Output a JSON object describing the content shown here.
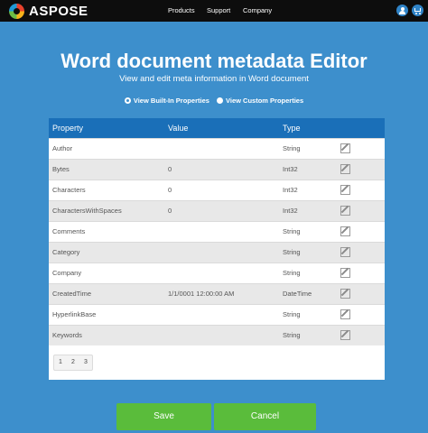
{
  "nav": {
    "brand": "ASPOSE",
    "products": "Products",
    "support": "Support",
    "company": "Company"
  },
  "header": {
    "title": "Word document metadata Editor",
    "subtitle": "View and edit meta information in Word document"
  },
  "view_options": [
    {
      "label": "View Built-In Properties",
      "selected": true
    },
    {
      "label": "View Custom Properties",
      "selected": false
    }
  ],
  "table": {
    "columns": [
      "Property",
      "Value",
      "Type"
    ],
    "rows": [
      {
        "property": "Author",
        "value": "",
        "type": "String"
      },
      {
        "property": "Bytes",
        "value": "0",
        "type": "Int32"
      },
      {
        "property": "Characters",
        "value": "0",
        "type": "Int32"
      },
      {
        "property": "CharactersWithSpaces",
        "value": "0",
        "type": "Int32"
      },
      {
        "property": "Comments",
        "value": "",
        "type": "String"
      },
      {
        "property": "Category",
        "value": "",
        "type": "String"
      },
      {
        "property": "Company",
        "value": "",
        "type": "String"
      },
      {
        "property": "CreatedTime",
        "value": "1/1/0001 12:00:00 AM",
        "type": "DateTime"
      },
      {
        "property": "HyperlinkBase",
        "value": "",
        "type": "String"
      },
      {
        "property": "Keywords",
        "value": "",
        "type": "String"
      }
    ]
  },
  "pagination": [
    "1",
    "2",
    "3"
  ],
  "actions": {
    "save": "Save",
    "cancel": "Cancel"
  },
  "colors": {
    "background": "#3d8fcc",
    "header_bar": "#1a6fb8",
    "button": "#5abc3b"
  }
}
